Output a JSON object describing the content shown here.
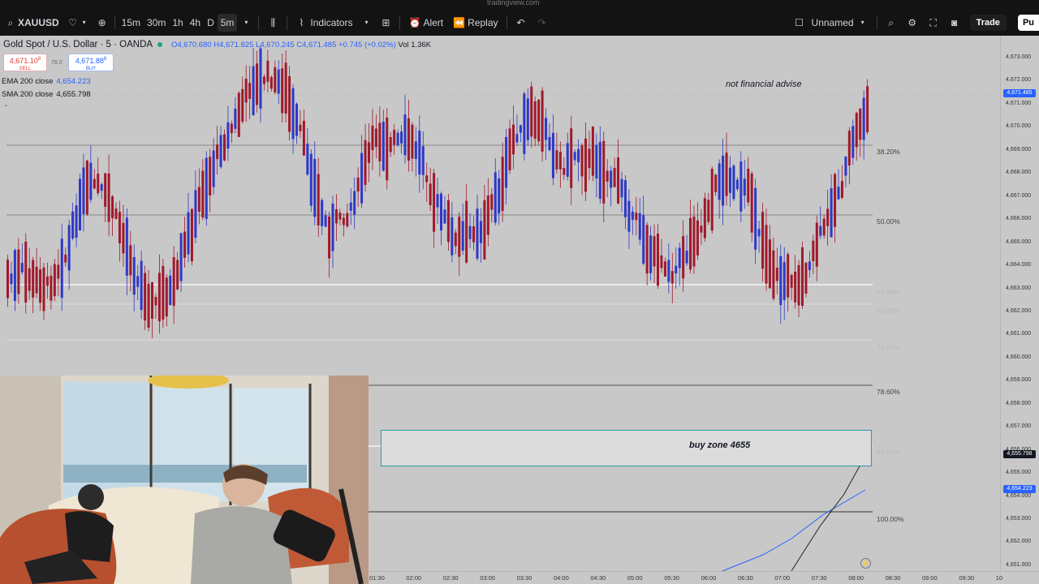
{
  "browser": {
    "url": "tradingview.com"
  },
  "toolbar": {
    "symbol": "XAUUSD",
    "intervals": [
      "15m",
      "30m",
      "1h",
      "4h",
      "D",
      "5m"
    ],
    "active_interval": "5m",
    "indicators_label": "Indicators",
    "alert_label": "Alert",
    "replay_label": "Replay",
    "layout_name": "Unnamed",
    "trade_label": "Trade",
    "publish_label": "Pu"
  },
  "legend": {
    "title": "Gold Spot / U.S. Dollar · 5 · OANDA",
    "ohlc": "O4,670.680 H4,671.825 L4,670.245 C4,671.485 +0.745 (+0.02%)",
    "volume": "Vol 1.36K",
    "sell_price": "4,671.10",
    "sell_sup": "8",
    "sell_label": "SELL",
    "spread": "78.0",
    "buy_price": "4,671.88",
    "buy_sup": "8",
    "buy_label": "BUY",
    "ema_label": "EMA 200 close",
    "ema_value": "4,654.223",
    "sma_label": "SMA 200 close",
    "sma_value": "4,655.798"
  },
  "annotations": {
    "note": "not financial advise",
    "buy_zone": "buy zone 4655"
  },
  "fib_levels": [
    "38.20%",
    "50.00%",
    "61.80%",
    "65.00%",
    "71.00%",
    "78.60%",
    "88.60%",
    "100.00%"
  ],
  "price_scale": [
    "4,673.000",
    "4,672.000",
    "4,671.000",
    "4,670.000",
    "4,669.000",
    "4,668.000",
    "4,667.000",
    "4,666.000",
    "4,665.000",
    "4,664.000",
    "4,663.000",
    "4,662.000",
    "4,661.000",
    "4,660.000",
    "4,659.000",
    "4,658.000",
    "4,657.000",
    "4,656.000",
    "4,655.000",
    "4,654.000",
    "4,653.000",
    "4,652.000",
    "4,651.000"
  ],
  "price_tags": {
    "last": "4,671.485",
    "sma": "4,655.798",
    "ema": "4,654.223"
  },
  "time_scale": [
    "01:30",
    "02:00",
    "02:30",
    "03:00",
    "03:30",
    "04:00",
    "04:30",
    "05:00",
    "05:30",
    "06:00",
    "06:30",
    "07:00",
    "07:30",
    "08:00",
    "08:30",
    "09:00",
    "09:30",
    "10"
  ],
  "colors": {
    "up": "#2e38c7",
    "down": "#a0192b",
    "zone_border": "#2a9aa8",
    "ema": "#2962ff"
  }
}
